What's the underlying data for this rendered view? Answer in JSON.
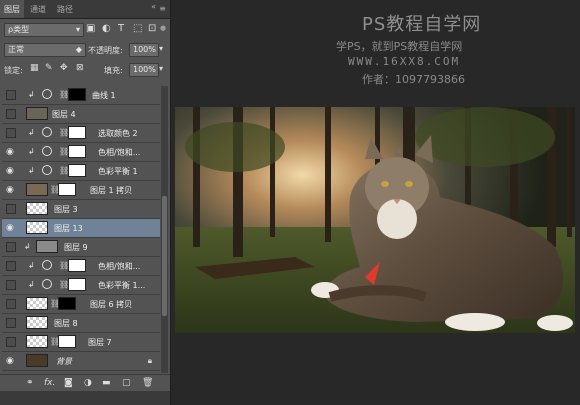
{
  "watermark": {
    "title": "PS教程自学网",
    "subtitle": "学PS，就到PS教程自学网",
    "url": "WWW.16XX8.COM",
    "author": "作者：1097793866"
  },
  "panel_tabs": [
    "图层",
    "通道",
    "路径"
  ],
  "controls": {
    "filter_label": "ρ类型",
    "blend_mode": "正常",
    "opacity_label": "不透明度:",
    "opacity_value": "100%",
    "lock_label": "锁定:",
    "fill_label": "填充:",
    "fill_value": "100%"
  },
  "layers": [
    {
      "name": "曲线 1",
      "visible": false,
      "kind": "adjust"
    },
    {
      "name": "图层 4",
      "visible": false,
      "kind": "pixel"
    },
    {
      "name": "选取颜色 2",
      "visible": false,
      "kind": "adjust"
    },
    {
      "name": "色相/饱和...",
      "visible": true,
      "kind": "adjust"
    },
    {
      "name": "色彩平衡 1",
      "visible": true,
      "kind": "adjust"
    },
    {
      "name": "图层 1 拷贝",
      "visible": true,
      "kind": "pixel-mask"
    },
    {
      "name": "图层 3",
      "visible": false,
      "kind": "pixel"
    },
    {
      "name": "图层 13",
      "visible": true,
      "kind": "pixel",
      "selected": true
    },
    {
      "name": "图层 9",
      "visible": false,
      "kind": "pixel-clip"
    },
    {
      "name": "色相/饱和...",
      "visible": false,
      "kind": "adjust"
    },
    {
      "name": "色彩平衡 1...",
      "visible": false,
      "kind": "adjust"
    },
    {
      "name": "图层 6 拷贝",
      "visible": false,
      "kind": "pixel-mask"
    },
    {
      "name": "图层 8",
      "visible": false,
      "kind": "pixel"
    },
    {
      "name": "图层 7",
      "visible": false,
      "kind": "pixel-mask"
    },
    {
      "name": "背景",
      "visible": true,
      "kind": "background"
    }
  ],
  "bottom_icons": [
    "link-icon",
    "fx-icon",
    "mask-icon",
    "adjustment-icon",
    "group-icon",
    "new-layer-icon",
    "trash-icon"
  ],
  "accent_selected": "#6f8298"
}
